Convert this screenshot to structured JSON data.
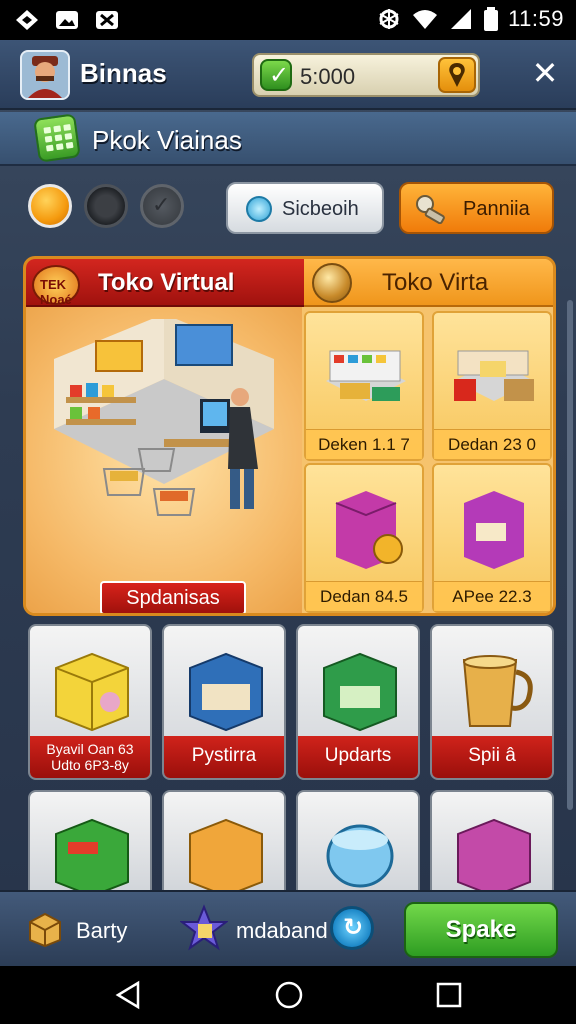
{
  "status_bar": {
    "time": "11:59"
  },
  "header": {
    "title": "Binnas",
    "coins": "5:000",
    "close_label": "✕"
  },
  "sub_header": {
    "title": "Pkok Viainas"
  },
  "toolbar": {
    "search_label": "Sicbeoih",
    "orange_label": "Panniia"
  },
  "featured": {
    "left_title": "Toko Virtual",
    "badge_text": "TEK Noaé",
    "right_title": "Toko Virta",
    "cta": "Spdanisas",
    "tiles": [
      {
        "label": "Deken 1.1 7"
      },
      {
        "label": "Dedan 23 0"
      },
      {
        "label": "Dedan 84.5"
      },
      {
        "label": "APee 22.3"
      }
    ]
  },
  "grid": [
    {
      "label_line1": "Byavil Oan 63",
      "label_line2": "Udto 6P3-8y"
    },
    {
      "label": "Pystirra"
    },
    {
      "label": "Updarts"
    },
    {
      "label": "Spii â"
    }
  ],
  "bottom_bar": {
    "label1": "Barty",
    "label2": "mdaband",
    "cta": "Spake"
  },
  "colors": {
    "accent_orange": "#f0961c",
    "accent_red": "#c81f18",
    "accent_green": "#3aa82a",
    "background": "#2e3c52"
  },
  "icons": [
    "signal-icon",
    "image-icon",
    "media-icon",
    "bluetooth-icon",
    "wifi-icon",
    "battery-icon",
    "avatar-icon",
    "check-icon",
    "location-pin-icon",
    "close-icon",
    "calculator-icon",
    "search-icon",
    "key-icon",
    "box-icon",
    "star-icon",
    "back-icon",
    "home-icon",
    "recents-icon"
  ]
}
